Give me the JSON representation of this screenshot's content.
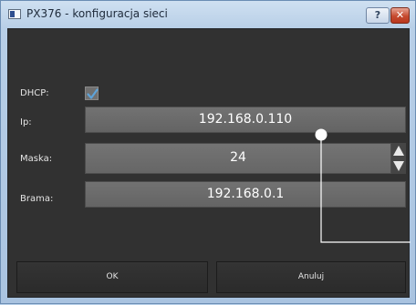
{
  "window": {
    "title": "PX376 - konfiguracja sieci",
    "help_label": "?",
    "close_label": "✕"
  },
  "form": {
    "dhcp_label": "DHCP:",
    "dhcp_checked": true,
    "ip_label": "Ip:",
    "ip_value": "192.168.0.110",
    "mask_label": "Maska:",
    "mask_value": "24",
    "gateway_label": "Brama:",
    "gateway_value": "192.168.0.1"
  },
  "buttons": {
    "ok_label": "OK",
    "cancel_label": "Anuluj"
  },
  "icons": {
    "app": "app-window-icon",
    "help": "help-icon",
    "close": "close-icon",
    "check": "check-icon",
    "up": "arrow-up-icon",
    "down": "arrow-down-icon"
  },
  "colors": {
    "client_bg": "#313131",
    "field_bg": "#6b6b6b",
    "accent_check": "#5ea3d9",
    "close_red": "#c64a2f"
  }
}
